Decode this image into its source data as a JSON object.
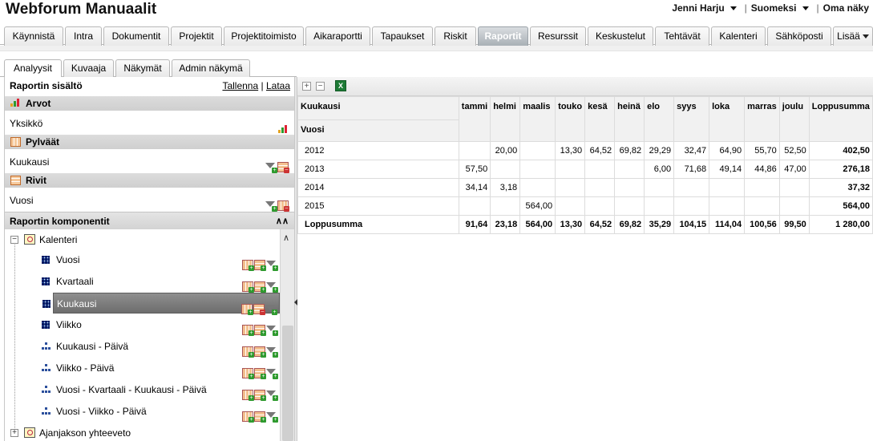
{
  "header": {
    "app_title": "Webforum Manuaalit",
    "user_name": "Jenni Harju",
    "language": "Suomeksi",
    "own_view": "Oma näky"
  },
  "nav": {
    "tabs": [
      {
        "label": "Käynnistä"
      },
      {
        "label": "Intra"
      },
      {
        "label": "Dokumentit"
      },
      {
        "label": "Projektit"
      },
      {
        "label": "Projektitoimisto"
      },
      {
        "label": "Aikaraportti"
      },
      {
        "label": "Tapaukset"
      },
      {
        "label": "Riskit"
      },
      {
        "label": "Raportit",
        "active": true
      },
      {
        "label": "Resurssit"
      },
      {
        "label": "Keskustelut"
      },
      {
        "label": "Tehtävät"
      },
      {
        "label": "Kalenteri"
      },
      {
        "label": "Sähköposti"
      },
      {
        "label": "Lisää"
      }
    ]
  },
  "subtabs": [
    {
      "label": "Analyysit",
      "active": true
    },
    {
      "label": "Kuvaaja"
    },
    {
      "label": "Näkymät"
    },
    {
      "label": "Admin näkymä"
    }
  ],
  "left_panel": {
    "content_title": "Raportin sisältö",
    "save_link": "Tallenna",
    "load_link": "Lataa",
    "link_separator": "|",
    "values_section": "Arvot",
    "values_item": "Yksikkö",
    "columns_section": "Pylväät",
    "columns_item": "Kuukausi",
    "rows_section": "Rivit",
    "rows_item": "Vuosi",
    "components_title": "Raportin komponentit",
    "tree": {
      "calendar": "Kalenteri",
      "items": [
        {
          "label": "Vuosi",
          "type": "grid"
        },
        {
          "label": "Kvartaali",
          "type": "grid"
        },
        {
          "label": "Kuukausi",
          "type": "grid",
          "selected": true
        },
        {
          "label": "Viikko",
          "type": "grid"
        },
        {
          "label": "Kuukausi - Päivä",
          "type": "hier"
        },
        {
          "label": "Viikko - Päivä",
          "type": "hier"
        },
        {
          "label": "Vuosi - Kvartaali - Kuukausi - Päivä",
          "type": "hier"
        },
        {
          "label": "Vuosi - Viikko - Päivä",
          "type": "hier"
        }
      ],
      "period_summary": "Ajanjakson yhteeveto"
    }
  },
  "pivot": {
    "col_axis_label": "Kuukausi",
    "row_axis_label": "Vuosi",
    "columns": [
      "tammi",
      "helmi",
      "maalis",
      "touko",
      "kesä",
      "heinä",
      "elo",
      "syys",
      "loka",
      "marras",
      "joulu",
      "Loppusumma"
    ],
    "rows": [
      {
        "label": "2012",
        "cells": [
          "",
          "20,00",
          "",
          "13,30",
          "64,52",
          "69,82",
          "29,29",
          "32,47",
          "64,90",
          "55,70",
          "52,50",
          "402,50"
        ]
      },
      {
        "label": "2013",
        "cells": [
          "57,50",
          "",
          "",
          "",
          "",
          "",
          "6,00",
          "71,68",
          "49,14",
          "44,86",
          "47,00",
          "276,18"
        ]
      },
      {
        "label": "2014",
        "cells": [
          "34,14",
          "3,18",
          "",
          "",
          "",
          "",
          "",
          "",
          "",
          "",
          "",
          "37,32"
        ]
      },
      {
        "label": "2015",
        "cells": [
          "",
          "",
          "564,00",
          "",
          "",
          "",
          "",
          "",
          "",
          "",
          "",
          "564,00"
        ]
      }
    ],
    "total_row": {
      "label": "Loppusumma",
      "cells": [
        "91,64",
        "23,18",
        "564,00",
        "13,30",
        "64,52",
        "69,82",
        "35,29",
        "104,15",
        "114,04",
        "100,56",
        "99,50",
        "1 280,00"
      ]
    }
  },
  "colors": {
    "active_tab": "#a5acb2",
    "selected_row": "#7a7a7a",
    "section_header": "#d4d4d4"
  }
}
